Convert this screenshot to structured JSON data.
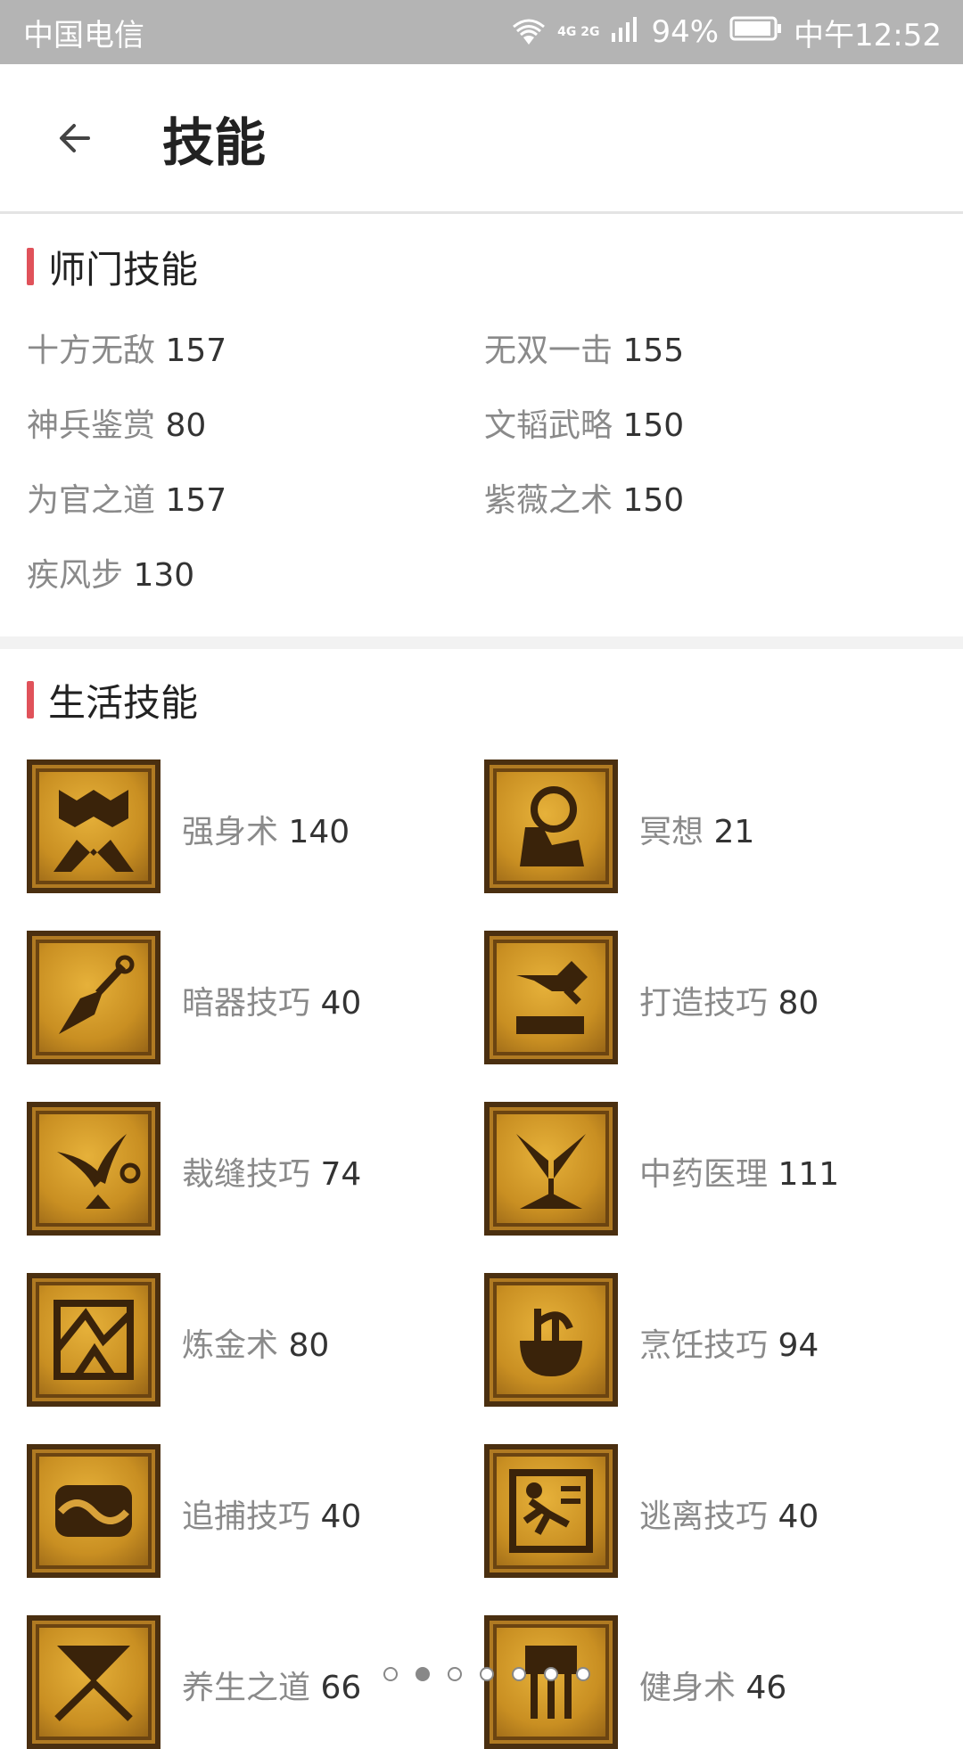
{
  "status": {
    "carrier": "中国电信",
    "network": "4G 2G",
    "battery_percent": "94%",
    "time": "中午12:52"
  },
  "header": {
    "title": "技能"
  },
  "sect_skills": {
    "title": "师门技能",
    "items": [
      {
        "name": "十方无敌",
        "value": "157"
      },
      {
        "name": "无双一击",
        "value": "155"
      },
      {
        "name": "神兵鉴赏",
        "value": "80"
      },
      {
        "name": "文韬武略",
        "value": "150"
      },
      {
        "name": "为官之道",
        "value": "157"
      },
      {
        "name": "紫薇之术",
        "value": "150"
      },
      {
        "name": "疾风步",
        "value": "130"
      }
    ]
  },
  "life_skills": {
    "title": "生活技能",
    "items": [
      {
        "name": "强身术",
        "value": "140",
        "icon": "strength-icon"
      },
      {
        "name": "冥想",
        "value": "21",
        "icon": "meditation-icon"
      },
      {
        "name": "暗器技巧",
        "value": "40",
        "icon": "dart-icon"
      },
      {
        "name": "打造技巧",
        "value": "80",
        "icon": "anvil-hammer-icon"
      },
      {
        "name": "裁缝技巧",
        "value": "74",
        "icon": "scissors-icon"
      },
      {
        "name": "中药医理",
        "value": "111",
        "icon": "herb-icon"
      },
      {
        "name": "炼金术",
        "value": "80",
        "icon": "alchemy-icon"
      },
      {
        "name": "烹饪技巧",
        "value": "94",
        "icon": "cooking-pot-icon"
      },
      {
        "name": "追捕技巧",
        "value": "40",
        "icon": "rope-icon"
      },
      {
        "name": "逃离技巧",
        "value": "40",
        "icon": "running-man-icon"
      },
      {
        "name": "养生之道",
        "value": "66",
        "icon": "wellness-icon"
      },
      {
        "name": "健身术",
        "value": "46",
        "icon": "fitness-icon"
      }
    ]
  },
  "pager": {
    "count": 7,
    "active_index": 1
  },
  "colors": {
    "accent": "#e0525a",
    "status_bar": "#b4b4b4",
    "icon_gold": "#c98f22"
  }
}
